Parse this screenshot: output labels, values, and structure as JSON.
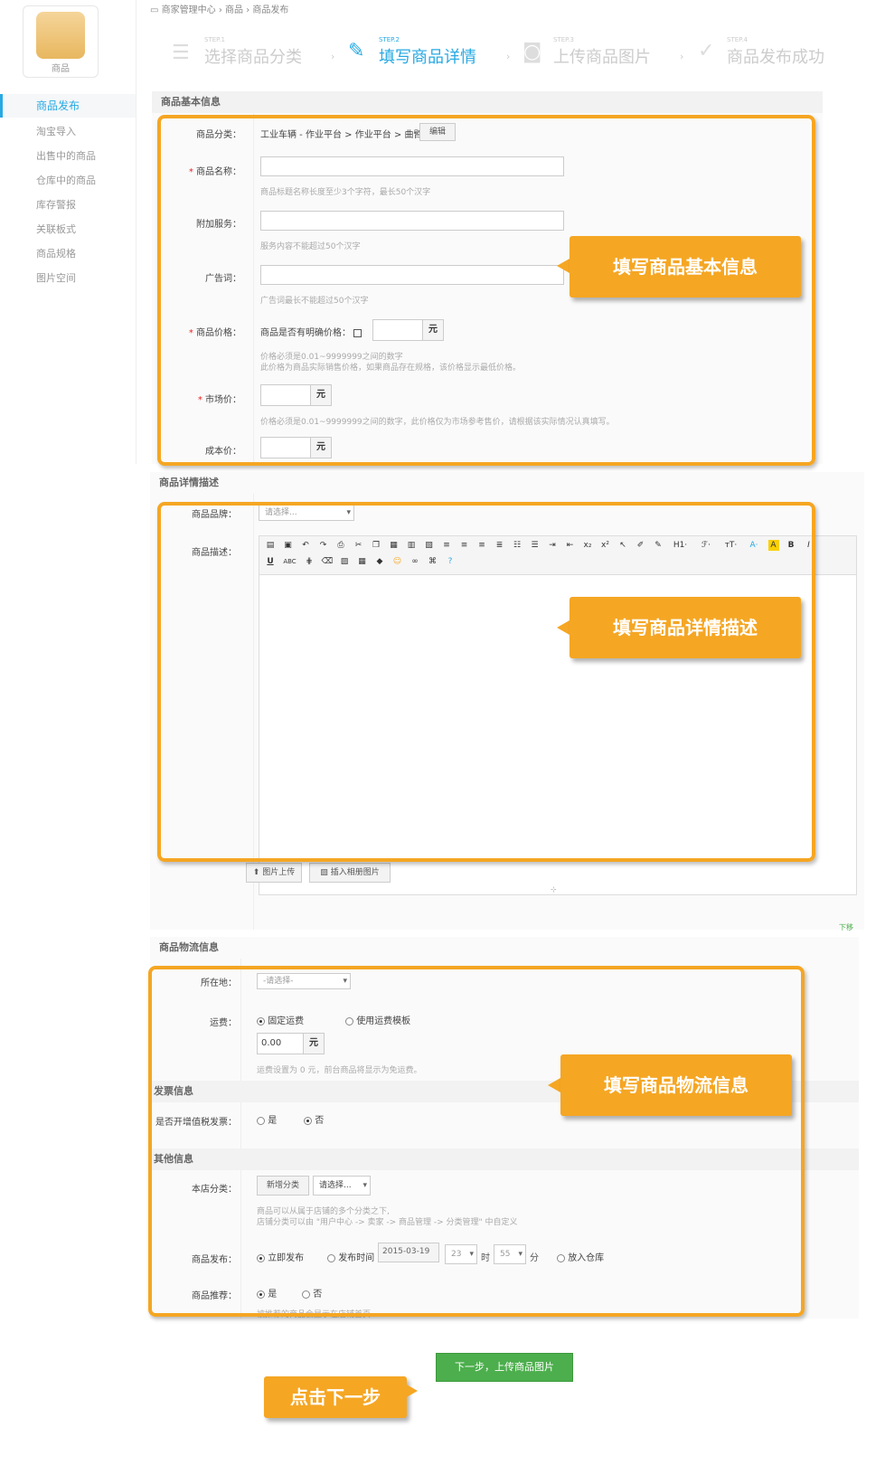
{
  "breadcrumb": {
    "home": "商家管理中心",
    "sep": "›",
    "level1": "商品",
    "level2": "商品发布"
  },
  "logo": {
    "label": "商品"
  },
  "sidebar": {
    "items": [
      "商品发布",
      "淘宝导入",
      "出售中的商品",
      "仓库中的商品",
      "库存警报",
      "关联板式",
      "商品规格",
      "图片空间"
    ]
  },
  "steps": [
    {
      "small": "STEP.1",
      "title": "选择商品分类"
    },
    {
      "small": "STEP.2",
      "title": "填写商品详情"
    },
    {
      "small": "STEP.3",
      "title": "上传商品图片"
    },
    {
      "small": "STEP.4",
      "title": "商品发布成功"
    }
  ],
  "basic": {
    "section_title": "商品基本信息",
    "category_label": "商品分类：",
    "category_value": "工业车辆 - 作业平台 > 作业平台 > 曲臂式",
    "edit_btn": "编辑",
    "name_label": "商品名称：",
    "name_hint": "商品标题名称长度至少3个字符，最长50个汉字",
    "service_label": "附加服务：",
    "service_hint": "服务内容不能超过50个汉字",
    "ad_label": "广告词：",
    "ad_hint": "广告词最长不能超过50个汉字",
    "price_label": "商品价格：",
    "price_question": "商品是否有明确价格：",
    "price_hint1": "价格必须是0.01~9999999之间的数字",
    "price_hint2": "此价格为商品实际销售价格，如果商品存在规格，该价格显示最低价格。",
    "market_label": "市场价：",
    "market_hint": "价格必须是0.01~9999999之间的数字，此价格仅为市场参考售价，请根据该实际情况认真填写。",
    "cost_label": "成本价：",
    "unit": "元",
    "required_star": "*"
  },
  "detail": {
    "section_title": "商品详情描述",
    "brand_label": "商品品牌：",
    "brand_placeholder": "请选择...",
    "desc_label": "商品描述：",
    "upload_btn": "图片上传",
    "album_btn": "插入相册图片",
    "toolbar_h1": "H1·",
    "toolbar_font": "ℱ·",
    "toolbar_size": "тT·",
    "toolbar_color": "A·",
    "toolbar_bold": "B",
    "toolbar_italic": "I",
    "toolbar_underline": "U",
    "toolbar_strike": "ABC",
    "toolbar_sub": "x₂",
    "toolbar_sup": "x²",
    "side_tail": "下移"
  },
  "logistics": {
    "section_title": "商品物流信息",
    "location_label": "所在地：",
    "location_placeholder": "-请选择-",
    "freight_label": "运费：",
    "freight_fixed": "固定运费",
    "freight_template": "使用运费模板",
    "freight_value": "0.00",
    "freight_hint": "运费设置为 0 元，前台商品将显示为免运费。",
    "invoice_title": "发票信息",
    "invoice_label": "是否开增值税发票：",
    "yes": "是",
    "no": "否",
    "other_title": "其他信息",
    "store_cat_label": "本店分类：",
    "add_cat_btn": "新增分类",
    "cat_select": "请选择...",
    "store_cat_hint1": "商品可以从属于店铺的多个分类之下,",
    "store_cat_hint2": "店铺分类可以由 \"用户中心 -> 卖家 -> 商品管理 -> 分类管理\" 中自定义",
    "publish_label": "商品发布：",
    "publish_now": "立即发布",
    "publish_time": "发布时间",
    "publish_date": "2015-03-19",
    "hour": "23",
    "hour_unit": "时",
    "minute": "55",
    "minute_unit": "分",
    "warehouse": "放入仓库",
    "recommend_label": "商品推荐：",
    "recommend_hint": "被推荐的商品会显示在店铺首页"
  },
  "callouts": {
    "basic": "填写商品基本信息",
    "detail": "填写商品详情描述",
    "logistics": "填写商品物流信息",
    "next": "点击下一步"
  },
  "next_button": "下一步，上传商品图片",
  "colors": {
    "accent": "#f5a623",
    "blue": "#27a9e3",
    "green": "#4cae4c"
  }
}
